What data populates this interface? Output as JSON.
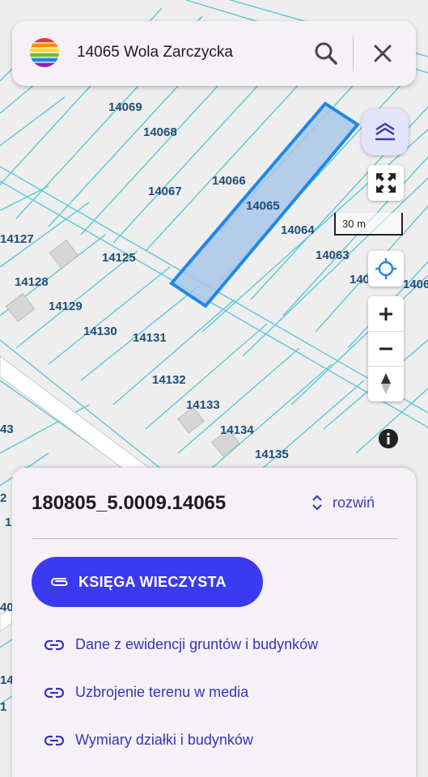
{
  "search": {
    "text": "14065 Wola Zarczycka"
  },
  "map": {
    "scale_label": "30 m",
    "selected_parcel_color": "#1e88e5",
    "parcel_lines_color": "#5bc8d8",
    "parcels": [
      {
        "label": "14069"
      },
      {
        "label": "14068"
      },
      {
        "label": "14067"
      },
      {
        "label": "14066"
      },
      {
        "label": "14065"
      },
      {
        "label": "14064"
      },
      {
        "label": "14063"
      },
      {
        "label": "140"
      },
      {
        "label": "1406"
      },
      {
        "label": "14127"
      },
      {
        "label": "14125"
      },
      {
        "label": "14128"
      },
      {
        "label": "14129"
      },
      {
        "label": "14130"
      },
      {
        "label": "14131"
      },
      {
        "label": "14132"
      },
      {
        "label": "14133"
      },
      {
        "label": "14134"
      },
      {
        "label": "14135"
      },
      {
        "label": "43"
      },
      {
        "label": "2"
      },
      {
        "label": "1"
      },
      {
        "label": "40"
      },
      {
        "label": "14"
      },
      {
        "label": "1"
      }
    ]
  },
  "panel": {
    "parcel_id": "180805_5.0009.14065",
    "expand_label": "rozwiń",
    "primary_button_label": "KSIĘGA WIECZYSTA",
    "links": [
      {
        "label": "Dane z ewidencji gruntów i budynków"
      },
      {
        "label": "Uzbrojenie terenu w media"
      },
      {
        "label": "Wymiary działki i budynków"
      }
    ]
  },
  "colors": {
    "accent": "#3a3af0",
    "link": "#3535b8",
    "panel_bg": "#f6f1f7"
  },
  "icons": {
    "logo": "rainbow-globe-icon",
    "search": "search-icon",
    "close": "close-icon",
    "layers": "layers-icon",
    "fullscreen": "fullscreen-icon",
    "locate": "my-location-icon",
    "zoom_in": "plus-icon",
    "zoom_out": "minus-icon",
    "compass": "compass-icon",
    "info": "info-icon",
    "expand": "unfold-icon",
    "link": "link-icon",
    "attachment": "paperclip-icon"
  }
}
